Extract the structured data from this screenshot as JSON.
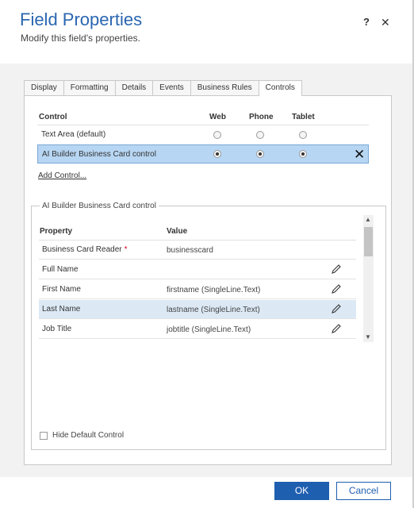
{
  "header": {
    "title": "Field Properties",
    "subtitle": "Modify this field's properties.",
    "help_label": "?",
    "close_label": "✕"
  },
  "tabs": [
    {
      "label": "Display",
      "active": false
    },
    {
      "label": "Formatting",
      "active": false
    },
    {
      "label": "Details",
      "active": false
    },
    {
      "label": "Events",
      "active": false
    },
    {
      "label": "Business Rules",
      "active": false
    },
    {
      "label": "Controls",
      "active": true
    }
  ],
  "controls_table": {
    "headers": {
      "control": "Control",
      "web": "Web",
      "phone": "Phone",
      "tablet": "Tablet"
    },
    "rows": [
      {
        "name": "Text Area (default)",
        "web": false,
        "phone": false,
        "tablet": false,
        "selected": false
      },
      {
        "name": "AI Builder Business Card control",
        "web": true,
        "phone": true,
        "tablet": true,
        "selected": true,
        "remove_label": "✕"
      }
    ],
    "add_link": "Add Control..."
  },
  "control_properties": {
    "legend": "AI Builder Business Card control",
    "headers": {
      "property": "Property",
      "value": "Value"
    },
    "rows": [
      {
        "property": "Business Card Reader",
        "required": true,
        "value": "businesscard",
        "editable": false,
        "selected": false
      },
      {
        "property": "Full Name",
        "required": false,
        "value": "",
        "editable": true,
        "selected": false
      },
      {
        "property": "First Name",
        "required": false,
        "value": "firstname (SingleLine.Text)",
        "editable": true,
        "selected": false
      },
      {
        "property": "Last Name",
        "required": false,
        "value": "lastname (SingleLine.Text)",
        "editable": true,
        "selected": true
      },
      {
        "property": "Job Title",
        "required": false,
        "value": "jobtitle (SingleLine.Text)",
        "editable": true,
        "selected": false
      }
    ],
    "required_marker": "*",
    "hide_default": {
      "label": "Hide Default Control",
      "checked": false
    }
  },
  "footer": {
    "ok_label": "OK",
    "cancel_label": "Cancel"
  },
  "colors": {
    "accent": "#1f5fb0",
    "title": "#2a66b0",
    "selected_row": "#b7d6f3",
    "required": "#d0021b"
  }
}
